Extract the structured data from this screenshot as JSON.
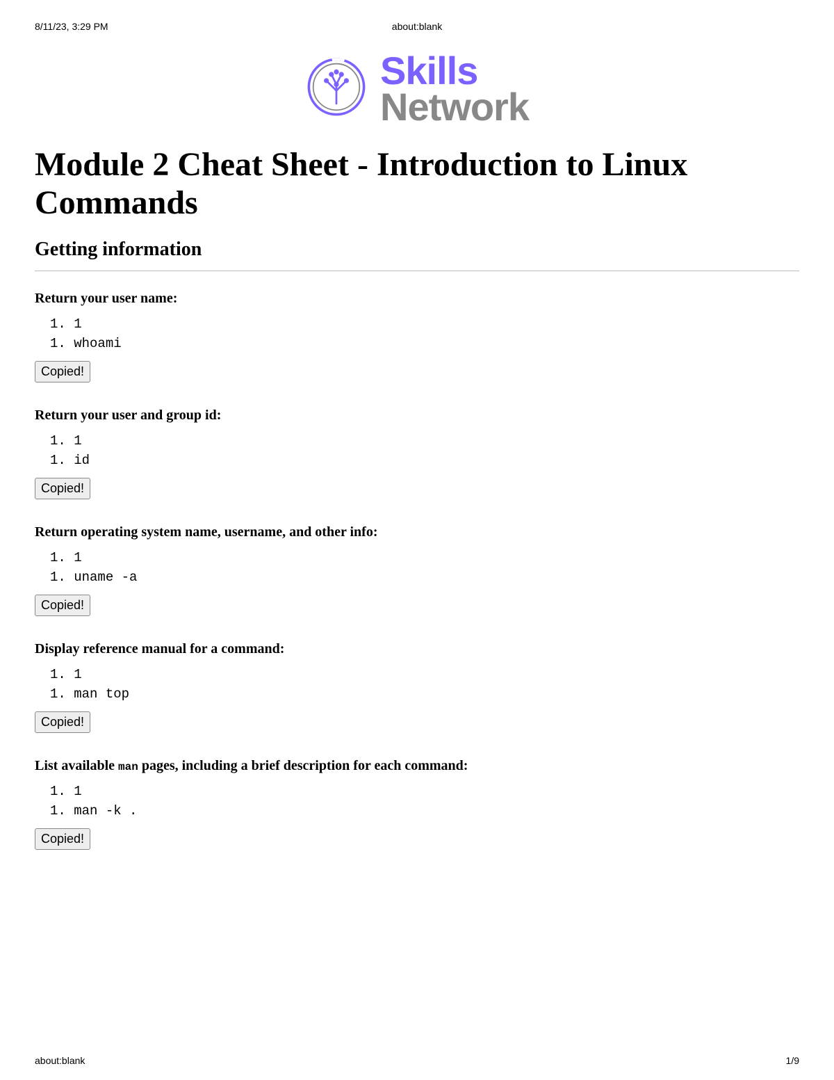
{
  "header": {
    "left": "8/11/23, 3:29 PM",
    "center": "about:blank"
  },
  "logo": {
    "line1": "Skills",
    "line2": "Network"
  },
  "title": "Module 2 Cheat Sheet - Introduction to Linux Commands",
  "section": "Getting information",
  "copied_label": "Copied!",
  "items": [
    {
      "heading": "Return your user name:",
      "line1": "1. 1",
      "line2": "1. whoami"
    },
    {
      "heading": "Return your user and group id:",
      "line1": "1. 1",
      "line2": "1. id"
    },
    {
      "heading": "Return operating system name, username, and other info:",
      "line1": "1. 1",
      "line2": "1. uname -a"
    },
    {
      "heading": "Display reference manual for a command:",
      "line1": "1. 1",
      "line2": "1. man top"
    },
    {
      "heading_pre": "List available ",
      "heading_mono": "man",
      "heading_post": " pages, including a brief description for each command:",
      "line1": "1. 1",
      "line2": "1. man -k ."
    }
  ],
  "footer": {
    "left": "about:blank",
    "right": "1/9"
  }
}
